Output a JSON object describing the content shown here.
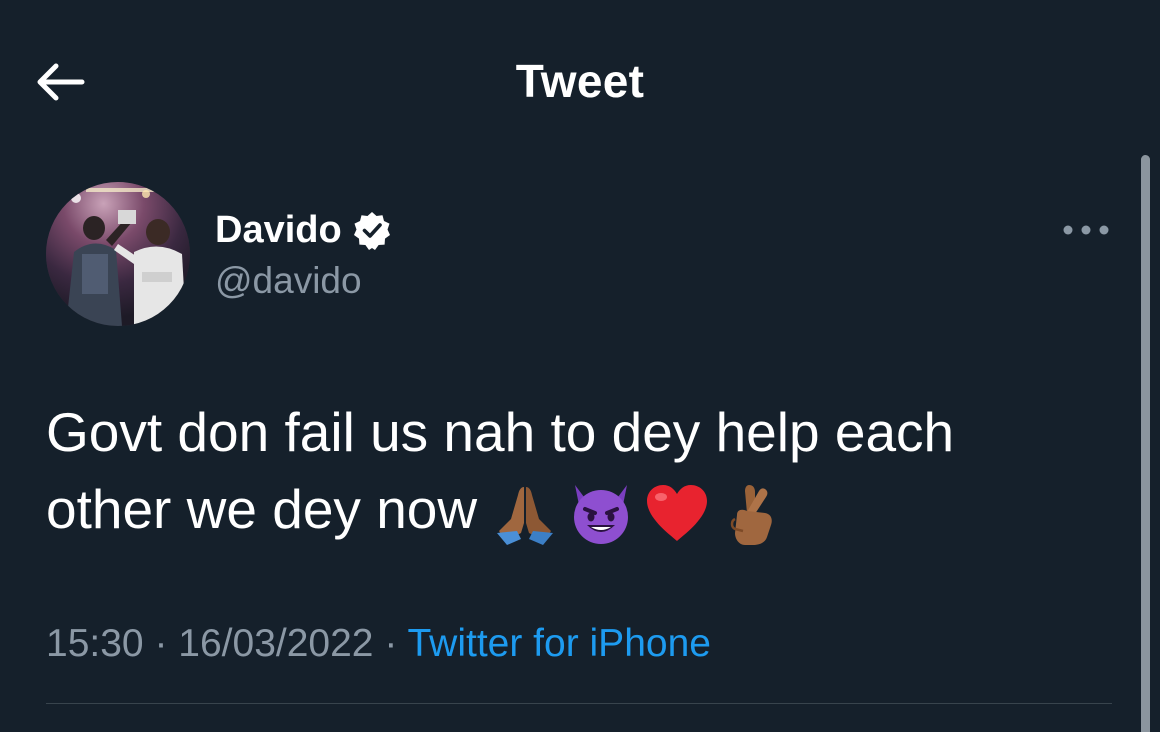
{
  "header": {
    "title": "Tweet",
    "back_icon": "arrow-left-icon"
  },
  "tweet": {
    "author": {
      "display_name": "Davido",
      "handle": "@davido",
      "verified": true,
      "avatar": "avatar-photo"
    },
    "more_icon": "ellipsis-horizontal-icon",
    "text_line_1": "Govt don fail us nah to dey help each",
    "text_line_2": "other we dey now",
    "emojis": [
      "folded-hands-medium-dark-skin",
      "smiling-face-with-horns",
      "red-heart",
      "crossed-fingers-medium-dark-skin"
    ],
    "time": "15:30",
    "separator": "·",
    "date": "16/03/2022",
    "source": "Twitter for iPhone"
  },
  "colors": {
    "background": "#15202b",
    "text": "#ffffff",
    "secondary_text": "#8b98a5",
    "link": "#1d9bf0",
    "divider": "#38444d"
  }
}
